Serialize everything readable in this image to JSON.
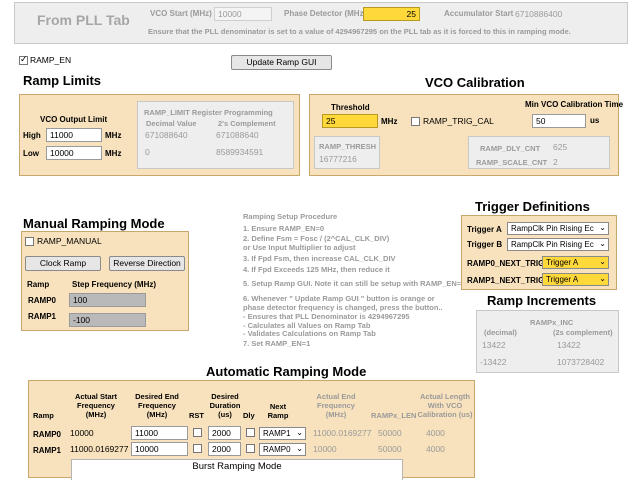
{
  "header": {
    "title": "From PLL Tab",
    "vco_start_label": "VCO Start (MHz)",
    "vco_start_value": "10000",
    "phase_detector_label": "Phase Detector (MHz)",
    "phase_detector_value": "25",
    "accumulator_start_label": "Accumulator Start",
    "accumulator_start_value": "6710886400",
    "note": "Ensure that the PLL denominator is set to a value of 4294967295 on the PLL tab as it is forced to this in ramping mode."
  },
  "ramp_en_label": "RAMP_EN",
  "update_button": "Update Ramp GUI",
  "ramp_limits": {
    "title": "Ramp Limits",
    "vco_output_limit": "VCO Output Limit",
    "high_label": "High",
    "high_value": "11000",
    "low_label": "Low",
    "low_value": "10000",
    "unit": "MHz",
    "reg_title": "RAMP_LIMIT Register Programming",
    "dec_header": "Decimal Value",
    "twos_header": "2's Complement",
    "high_dec": "671088640",
    "high_twos": "671088640",
    "low_dec": "0",
    "low_twos": "8589934591"
  },
  "vco_cal": {
    "title": "VCO Calibration",
    "threshold_label": "Threshold",
    "threshold_value": "25",
    "threshold_unit": "MHz",
    "trig_cal_label": "RAMP_TRIG_CAL",
    "min_time_label": "Min VCO Calibration Time",
    "min_time_value": "50",
    "min_time_unit": "us",
    "thresh_reg_label": "RAMP_THRESH",
    "thresh_reg_value": "16777216",
    "dly_cnt_label": "RAMP_DLY_CNT",
    "dly_cnt_value": "625",
    "scale_cnt_label": "RAMP_SCALE_CNT",
    "scale_cnt_value": "2"
  },
  "manual": {
    "title": "Manual Ramping Mode",
    "ramp_manual_label": "RAMP_MANUAL",
    "clock_ramp_button": "Clock Ramp",
    "reverse_button": "Reverse Direction",
    "ramp_header": "Ramp",
    "step_header": "Step Frequency (MHz)",
    "ramp0_label": "RAMP0",
    "ramp0_value": "100",
    "ramp1_label": "RAMP1",
    "ramp1_value": "-100"
  },
  "procedure": {
    "title": "Ramping Setup Procedure",
    "lines": [
      "1.  Ensure RAMP_EN=0",
      "2.  Define  Fsm = Fosc / (2^CAL_CLK_DIV)",
      "     or Use Input Multiplier to adjust",
      "3.  If Fpd    Fsm, then increase CAL_CLK_DIV",
      "4.  If Fpd Exceeds 125 MHz, then reduce it",
      "5.  Setup Ramp GUI.  Note it can still be setup with RAMP_EN=0",
      "6.  Whenever \" Update Ramp GUI \" button is orange or",
      "     phase detector frequency is changed, press the button..",
      "     - Ensures that PLL Denominator is 4294967295",
      "     - Calculates all Values on Ramp Tab",
      "     - Validates Calculations on Ramp Tab",
      "7.  Set RAMP_EN=1"
    ]
  },
  "trigger": {
    "title": "Trigger Definitions",
    "trig_a_label": "Trigger A",
    "trig_a_value": "RampClk Pin Rising Ec",
    "trig_b_label": "Trigger B",
    "trig_b_value": "RampClk Pin Rising Ec",
    "ramp0_next_label": "RAMP0_NEXT_TRIG",
    "ramp0_next_value": "Trigger A",
    "ramp1_next_label": "RAMP1_NEXT_TRIG",
    "ramp1_next_value": "Trigger A"
  },
  "increments": {
    "title": "Ramp Increments",
    "header": "RAMPx_INC",
    "dec_header": "(decimal)",
    "twos_header": "(2s complement)",
    "r0_dec": "13422",
    "r0_twos": "13422",
    "r1_dec": "-13422",
    "r1_twos": "1073728402"
  },
  "auto": {
    "title": "Automatic Ramping Mode",
    "headers": {
      "ramp": "Ramp",
      "start": "Actual Start Frequency (MHz)",
      "end": "Desired End Frequency (MHz)",
      "rst": "RST",
      "duration": "Desired Duration (us)",
      "dly": "Dly",
      "next": "Next Ramp",
      "actual_end": "Actual End Frequency (MHz)",
      "len": "RAMPx_LEN",
      "actual_len": "Actual Length With VCO Calibration (us)"
    },
    "rows": [
      {
        "name": "RAMP0",
        "start": "10000",
        "end": "11000",
        "duration": "2000",
        "next": "RAMP1",
        "actual_end": "11000.0169277",
        "len": "50000",
        "actual_len": "4000"
      },
      {
        "name": "RAMP1",
        "start": "11000.0169277",
        "end": "10000",
        "duration": "2000",
        "next": "RAMP0",
        "actual_end": "10000",
        "len": "50000",
        "actual_len": "4000"
      }
    ],
    "burst_label": "Burst Ramping Mode"
  },
  "colors": {
    "panel": "#f8e2bd",
    "accent_yellow": "#ffd83a"
  }
}
